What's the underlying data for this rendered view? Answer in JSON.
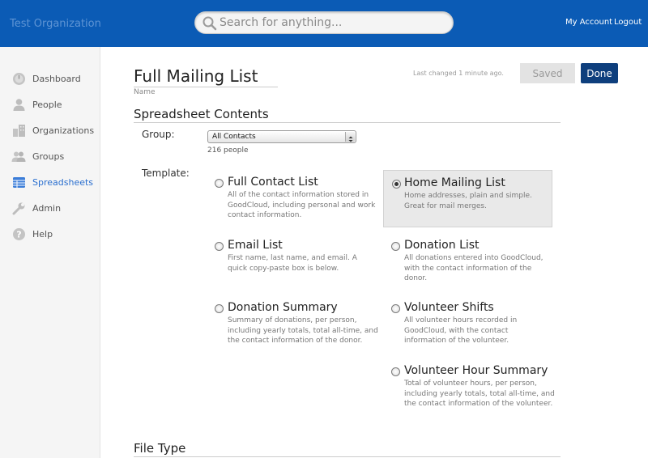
{
  "app": {
    "org_name": "Test Organization",
    "search_placeholder": "Search for anything...",
    "search_value": "",
    "links": {
      "my_account": "My Account",
      "logout": "Logout"
    }
  },
  "sidebar": {
    "items": [
      {
        "label": "Dashboard",
        "icon": "dashboard-icon",
        "active": false
      },
      {
        "label": "People",
        "icon": "person-icon",
        "active": false
      },
      {
        "label": "Organizations",
        "icon": "buildings-icon",
        "active": false
      },
      {
        "label": "Groups",
        "icon": "group-icon",
        "active": false
      },
      {
        "label": "Spreadsheets",
        "icon": "spreadsheet-icon",
        "active": true
      },
      {
        "label": "Admin",
        "icon": "wrench-icon",
        "active": false
      },
      {
        "label": "Help",
        "icon": "help-icon",
        "active": false
      }
    ],
    "active_color": "#2a6fcf"
  },
  "header": {
    "title_value": "Full Mailing List",
    "name_label": "Name",
    "last_changed": "Last changed 1 minute ago.",
    "saved_label": "Saved",
    "done_label": "Done"
  },
  "contents": {
    "heading": "Spreadsheet Contents",
    "group_label": "Group:",
    "group_value": "All Contacts",
    "people_count": "216 people",
    "template_label": "Template:",
    "templates": [
      {
        "title": "Full Contact List",
        "desc": "All of the contact information stored in GoodCloud, including personal and work contact information.",
        "selected": false
      },
      {
        "title": "Home Mailing List",
        "desc": "Home addresses, plain and simple. Great for mail merges.",
        "selected": true
      },
      {
        "title": "Email List",
        "desc": "First name, last name, and email. A quick copy-paste box is below.",
        "selected": false
      },
      {
        "title": "Donation List",
        "desc": "All donations entered into GoodCloud, with the contact information of the donor.",
        "selected": false
      },
      {
        "title": "Donation Summary",
        "desc": "Summary of donations, per person, including yearly totals, total all-time, and the contact information of the donor.",
        "selected": false
      },
      {
        "title": "Volunteer Shifts",
        "desc": "All volunteer hours recorded in GoodCloud, with the contact information of the volunteer.",
        "selected": false
      },
      {
        "title": "Volunteer Hour Summary",
        "desc": "Total of volunteer hours, per person, including yearly totals, total all-time, and the contact information of the volunteer.",
        "selected": false
      }
    ]
  },
  "file_type": {
    "heading": "File Type"
  },
  "colors": {
    "topbar": "#0b5bb5",
    "done_button": "#0e3f7d",
    "sidebar_bg": "#f5f5f5"
  }
}
